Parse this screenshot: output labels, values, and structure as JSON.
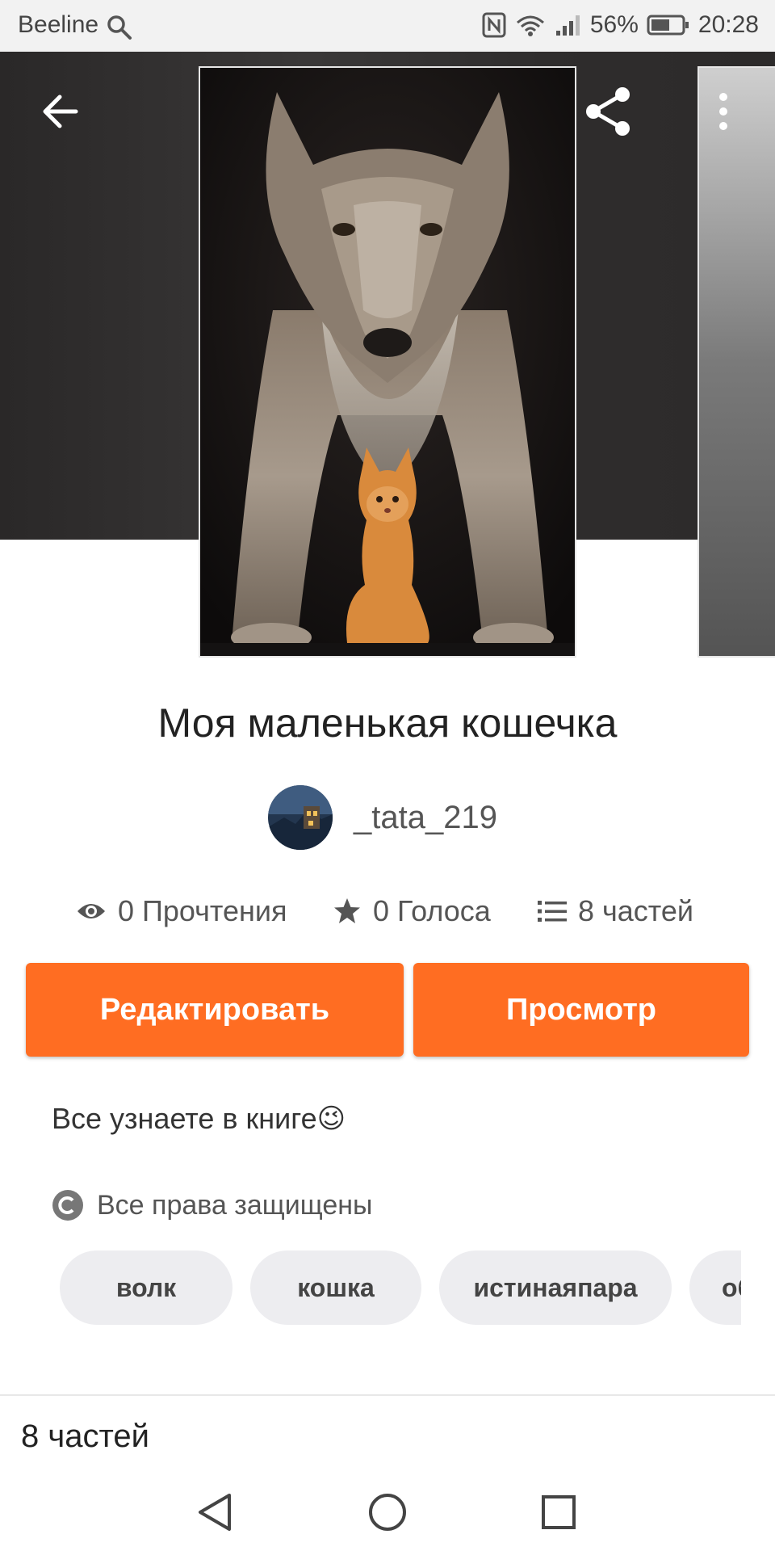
{
  "status_bar": {
    "carrier": "Beeline",
    "battery": "56%",
    "time": "20:28",
    "icons": [
      "search-icon",
      "nfc-icon",
      "wifi-icon",
      "signal-icon",
      "battery-icon"
    ]
  },
  "header": {
    "back_icon": "arrow-left-icon",
    "share_icon": "share-icon",
    "more_icon": "more-vertical-icon"
  },
  "story": {
    "title": "Моя маленькая кошечка",
    "author": "_tata_219",
    "stats": {
      "reads": "0 Прочтения",
      "votes": "0 Голоса",
      "parts": "8 частей"
    },
    "description": "Все узнаете в книге",
    "description_emoji": "😉",
    "copyright": "Все права защищены"
  },
  "actions": {
    "edit_label": "Редактировать",
    "view_label": "Просмотр"
  },
  "tags": [
    "волк",
    "кошка",
    "истинаяпара",
    "об"
  ],
  "parts_section": {
    "heading": "8 частей"
  },
  "colors": {
    "accent": "#ff6d22",
    "tag_bg": "#ededf0",
    "hero_bg": "#2f2d2d"
  }
}
